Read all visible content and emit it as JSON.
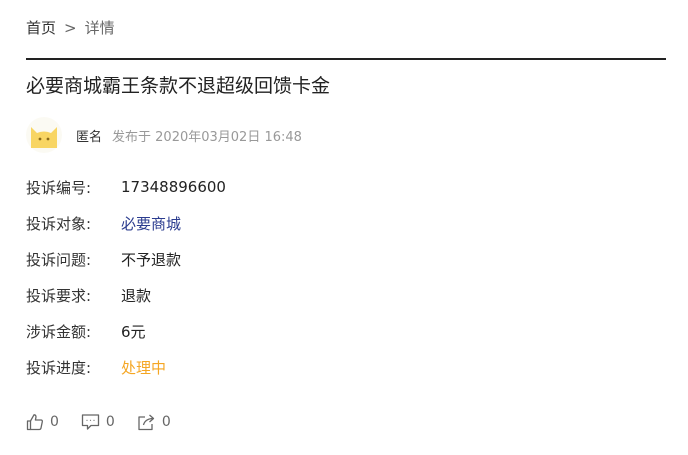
{
  "breadcrumb": {
    "home": "首页",
    "separator": ">",
    "current": "详情"
  },
  "complaint": {
    "title": "必要商城霸王条款不退超级回馈卡金",
    "author": "匿名",
    "post_time": "发布于 2020年03月02日 16:48",
    "fields": [
      {
        "label": "投诉编号:",
        "value": "17348896600"
      },
      {
        "label": "投诉对象:",
        "value": "必要商城"
      },
      {
        "label": "投诉问题:",
        "value": "不予退款"
      },
      {
        "label": "投诉要求:",
        "value": "退款"
      },
      {
        "label": "涉诉金额:",
        "value": "6元"
      },
      {
        "label": "投诉进度:",
        "value": "处理中"
      }
    ]
  },
  "actions": {
    "like_count": "0",
    "comment_count": "0",
    "share_count": "0"
  },
  "colors": {
    "link": "#2b3c8f",
    "status": "#f5a623",
    "avatar": "#f8d563"
  }
}
